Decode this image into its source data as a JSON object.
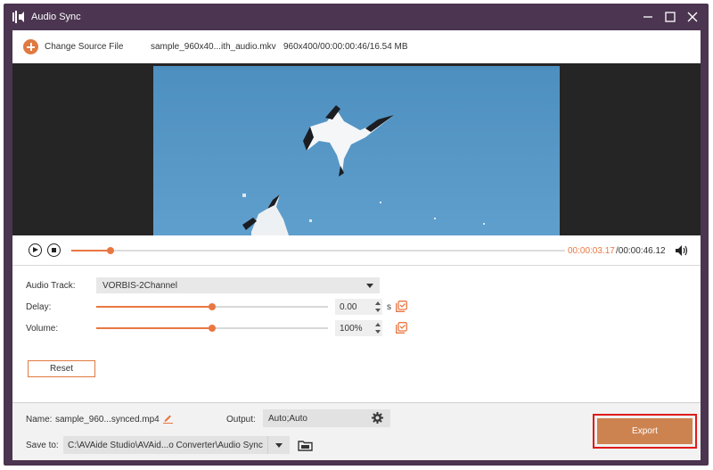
{
  "window": {
    "title": "Audio Sync",
    "colors": {
      "frame": "#4b3550",
      "accent": "#e97742",
      "export": "#cd8350",
      "highlight": "#e01b1b"
    }
  },
  "toolbar": {
    "change_source_label": "Change Source File",
    "file_name": "sample_960x40...ith_audio.mkv",
    "file_info": "960x400/00:00:00:46/16.54 MB"
  },
  "player": {
    "current_time": "00:00:03.17",
    "total_time": "/00:00:46.12",
    "progress_percent": 8
  },
  "settings": {
    "audio_track_label": "Audio Track:",
    "audio_track_value": "VORBIS-2Channel",
    "delay_label": "Delay:",
    "delay_value": "0.00",
    "delay_unit": "s",
    "delay_slider_percent": 50,
    "volume_label": "Volume:",
    "volume_value": "100%",
    "volume_slider_percent": 50,
    "reset_label": "Reset"
  },
  "output": {
    "name_label": "Name:",
    "name_value": "sample_960...synced.mp4",
    "output_label": "Output:",
    "output_value": "Auto;Auto",
    "save_to_label": "Save to:",
    "save_to_value": "C:\\AVAide Studio\\AVAid...o Converter\\Audio Sync",
    "export_label": "Export"
  },
  "icons": [
    "app-sound-icon",
    "minimize-icon",
    "maximize-icon",
    "close-icon",
    "add-icon",
    "play-icon",
    "stop-icon",
    "volume-icon",
    "copy-icon",
    "edit-icon",
    "gear-icon",
    "folder-icon"
  ]
}
